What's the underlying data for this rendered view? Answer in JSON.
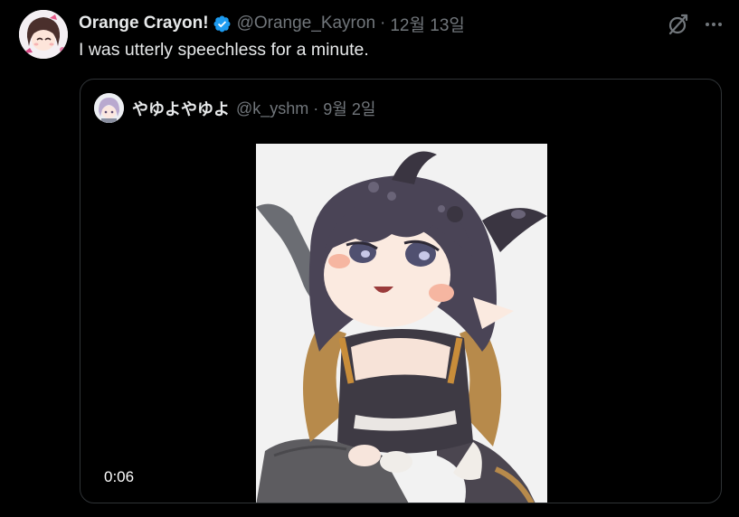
{
  "tweet": {
    "author": {
      "display_name": "Orange Crayon!",
      "handle": "@Orange_Kayron",
      "verified": true,
      "avatar_icon": "author-avatar"
    },
    "separator": "·",
    "date": "12월 13일",
    "text": "I was utterly speechless for a minute.",
    "actions": {
      "grok_icon": "grok-icon",
      "more_icon": "more-options-icon"
    }
  },
  "quoted_tweet": {
    "author": {
      "display_name": "やゆよやゆよ",
      "handle": "@k_yshm",
      "avatar_icon": "quoted-author-avatar"
    },
    "separator": "·",
    "date": "9월 2일",
    "media": {
      "type": "video",
      "duration": "0:06"
    }
  },
  "colors": {
    "background": "#000000",
    "primary_text": "#e7e9ea",
    "secondary_text": "#71767b",
    "border": "#2f3336",
    "verified_badge": "#1d9bf0"
  }
}
